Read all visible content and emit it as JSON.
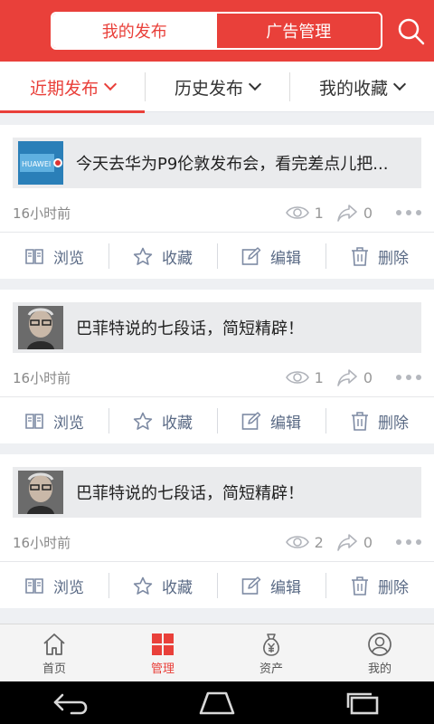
{
  "header": {
    "tab_my_posts": "我的发布",
    "tab_ad_manage": "广告管理"
  },
  "subtabs": [
    "近期发布",
    "历史发布",
    "我的收藏"
  ],
  "posts": [
    {
      "title": "今天去华为P9伦敦发布会，看完差点儿把...",
      "time": "16小时前",
      "views": "1",
      "shares": "0",
      "thumb": "huawei-banner"
    },
    {
      "title": "巴菲特说的七段话，简短精辟！",
      "time": "16小时前",
      "views": "1",
      "shares": "0",
      "thumb": "portrait"
    },
    {
      "title": "巴菲特说的七段话，简短精辟！",
      "time": "16小时前",
      "views": "2",
      "shares": "0",
      "thumb": "portrait"
    }
  ],
  "actions": {
    "view": "浏览",
    "favorite": "收藏",
    "edit": "编辑",
    "delete": "删除"
  },
  "bottomnav": {
    "home": "首页",
    "manage": "管理",
    "assets": "资产",
    "mine": "我的"
  },
  "colors": {
    "accent": "#e9403a",
    "action_text": "#5a6a85",
    "muted": "#999999"
  }
}
